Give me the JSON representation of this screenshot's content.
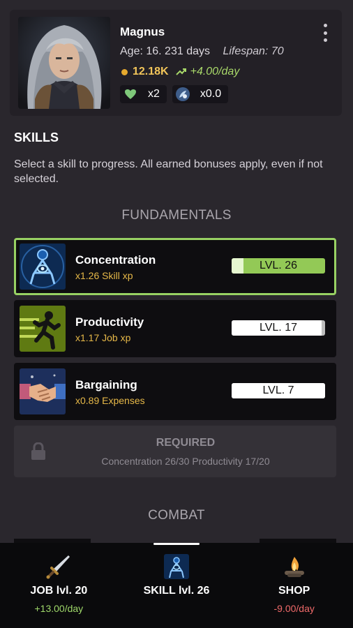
{
  "character": {
    "name": "Magnus",
    "age": "Age: 16. 231 days",
    "lifespan": "Lifespan: 70",
    "gold": "12.18K",
    "income": "+4.00/day",
    "hearts": "x2",
    "essence": "x0.0"
  },
  "skills_section": {
    "title": "SKILLS",
    "description": "Select a skill to progress. All earned bonuses apply, even if not selected."
  },
  "categories": {
    "fundamentals": "FUNDAMENTALS",
    "combat": "COMBAT"
  },
  "skills": [
    {
      "name": "Concentration",
      "bonus": "x1.26 Skill xp",
      "level": "LVL. 26",
      "progress": 0.13,
      "selected": true,
      "icon": "concentration-icon"
    },
    {
      "name": "Productivity",
      "bonus": "x1.17 Job xp",
      "level": "LVL. 17",
      "progress": 0.96,
      "selected": false,
      "icon": "running-figure-icon"
    },
    {
      "name": "Bargaining",
      "bonus": "x0.89 Expenses",
      "level": "LVL. 7",
      "progress": 1.0,
      "selected": false,
      "icon": "handshake-icon"
    }
  ],
  "locked_skill": {
    "title": "REQUIRED",
    "requirements": "Concentration 26/30 Productivity 17/20"
  },
  "nav": [
    {
      "label": "JOB lvl. 20",
      "sub": "+13.00/day",
      "icon": "sword-icon",
      "active": false
    },
    {
      "label": "SKILL lvl. 26",
      "sub": "",
      "icon": "concentration-icon",
      "active": true
    },
    {
      "label": "SHOP",
      "sub": "-9.00/day",
      "icon": "campfire-icon",
      "active": false
    }
  ],
  "colors": {
    "background": "#2a272d",
    "selected_border": "#98d163",
    "gold": "#f2c55a",
    "positive": "#9fd86a",
    "negative": "#f06a6a",
    "bonus_text": "#e6b848"
  }
}
